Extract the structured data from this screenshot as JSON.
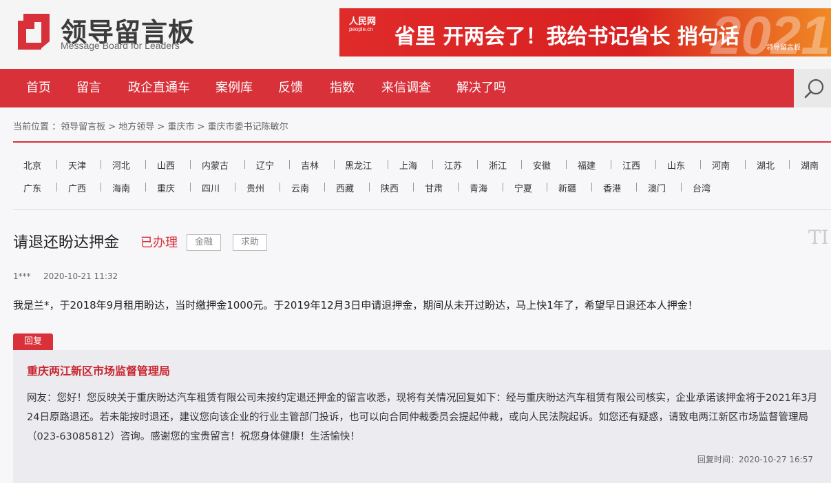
{
  "header": {
    "logo_title": "领导留言板",
    "logo_subtitle": "Message Board for Leaders",
    "banner": {
      "brand": "人民网",
      "brand_sub": "people.cn",
      "text": "省里 开两会了！我给书记省长 捎句话",
      "number": "2021",
      "corner_text": "领导留言板"
    }
  },
  "nav": {
    "items": [
      "首页",
      "留言",
      "政企直通车",
      "案例库",
      "反馈",
      "指数",
      "来信调查",
      "解决了吗"
    ],
    "search_icon": "search-icon"
  },
  "breadcrumb": "当前位置 ：领导留言板 > 地方领导 > 重庆市 > 重庆市委书记陈敏尔",
  "regions": {
    "row1": [
      "北京",
      "天津",
      "河北",
      "山西",
      "内蒙古",
      "辽宁",
      "吉林",
      "黑龙江",
      "上海",
      "江苏",
      "浙江",
      "安徽",
      "福建",
      "江西",
      "山东",
      "河南",
      "湖北",
      "湖南"
    ],
    "row2": [
      "广东",
      "广西",
      "海南",
      "重庆",
      "四川",
      "贵州",
      "云南",
      "西藏",
      "陕西",
      "甘肃",
      "青海",
      "宁夏",
      "新疆",
      "香港",
      "澳门",
      "台湾"
    ]
  },
  "message": {
    "title": "请退还盼达押金",
    "status": "已办理",
    "tags": [
      "金融",
      "求助"
    ],
    "user": "1***",
    "time": "2020-10-21 11:32",
    "body": "我是兰*，于2018年9月租用盼达，当时缴押金1000元。于2019年12月3日申请退押金，期间从未开过盼达，马上快1年了，希望早日退还本人押金！"
  },
  "reply": {
    "badge": "回复",
    "org": "重庆两江新区市场监督管理局",
    "text": "网友：您好！您反映关于重庆盼达汽车租赁有限公司未按约定退还押金的留言收悉，现将有关情况回复如下：经与重庆盼达汽车租赁有限公司核实，企业承诺该押金将于2021年3月24日原路退还。若未能按时退还，建议您向该企业的行业主管部门投诉，也可以向合同仲裁委员会提起仲裁，或向人民法院起诉。如您还有疑惑，请致电两江新区市场监督管理局（023-63085812）咨询。感谢您的宝贵留言！祝您身体健康！生活愉快！",
    "time": "回复时间：2020-10-27 16:57"
  },
  "font_toggle": "TI",
  "colors": {
    "accent": "#d9313a",
    "reply_bg": "#ecebef"
  }
}
